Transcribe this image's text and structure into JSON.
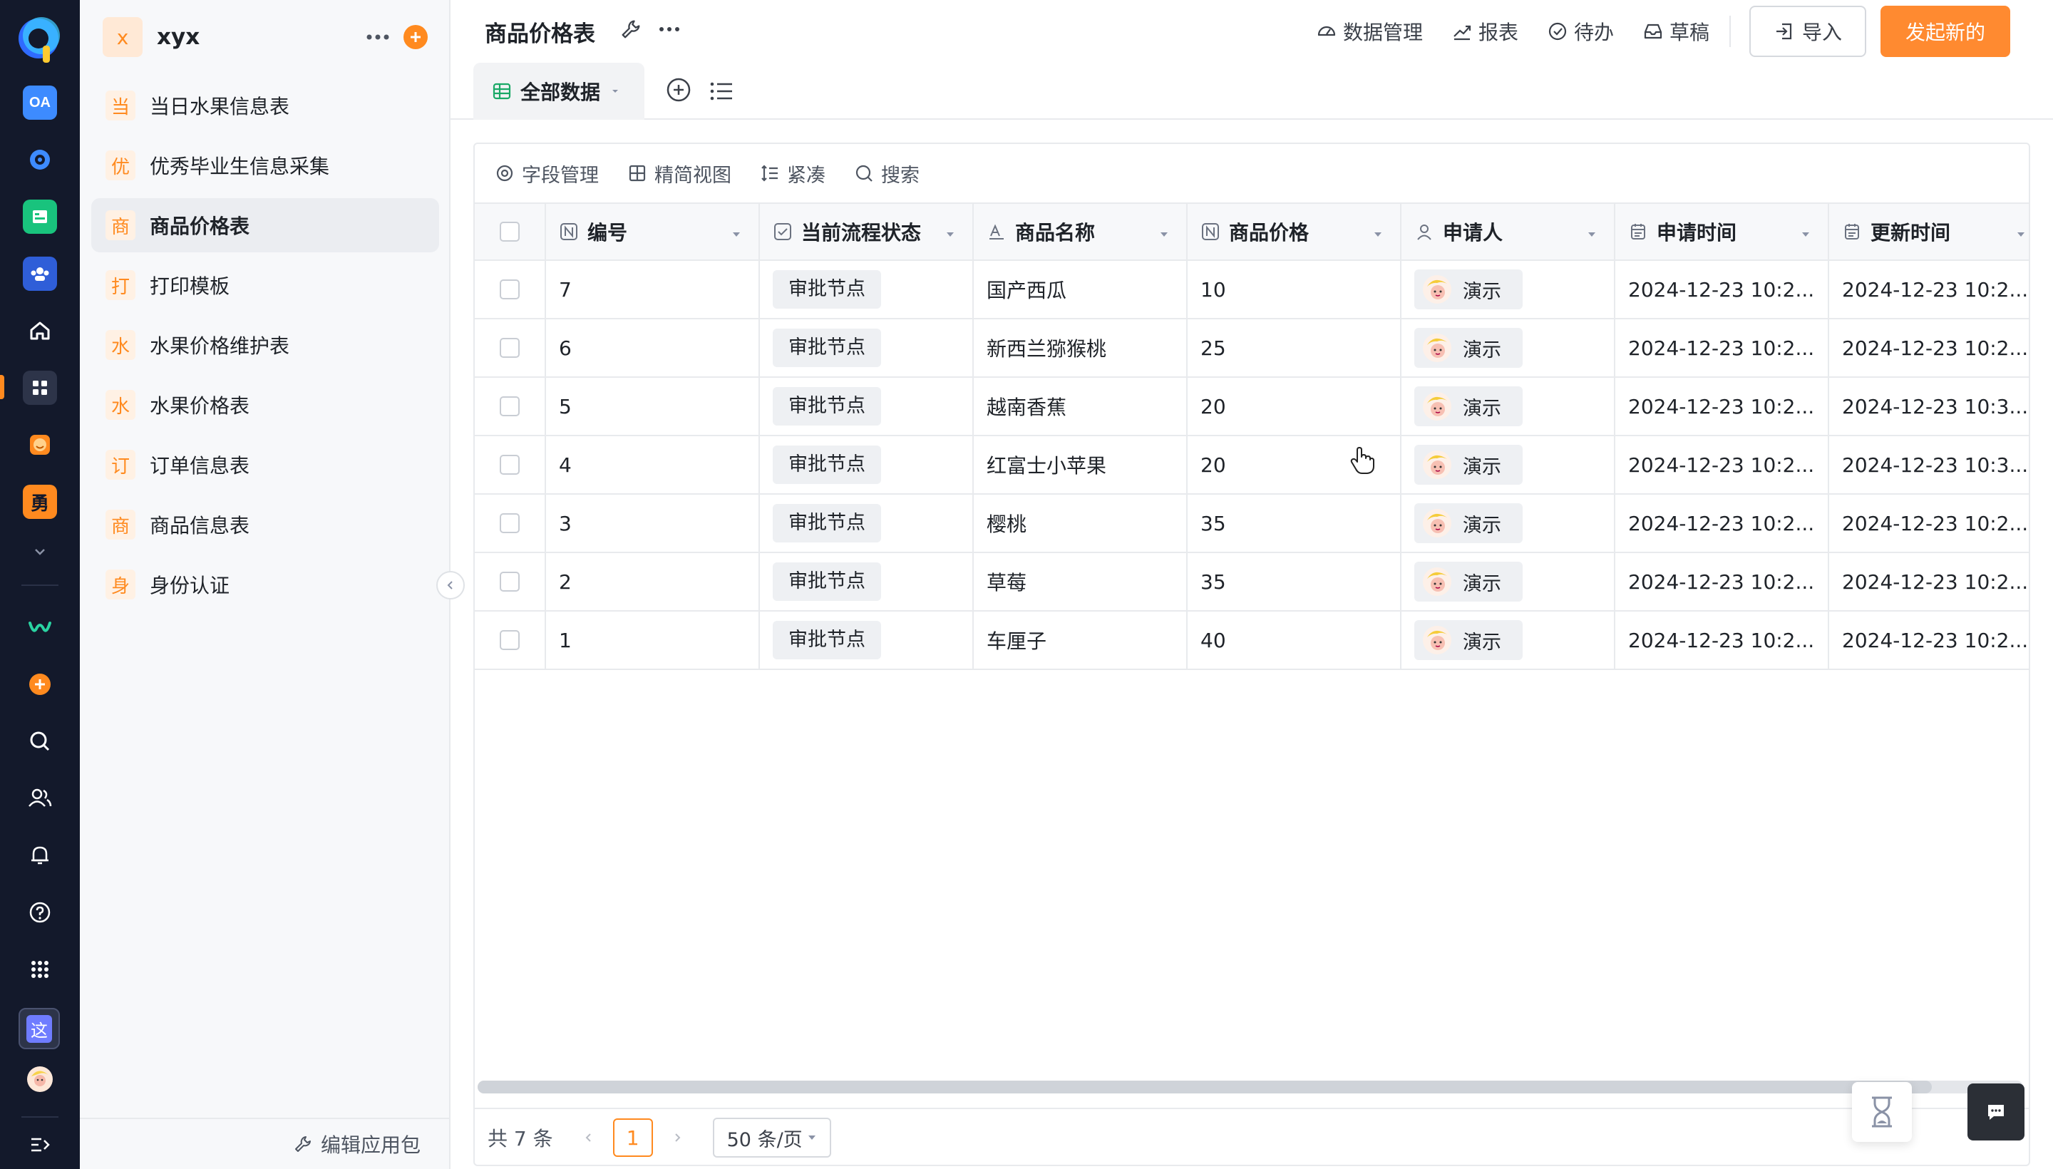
{
  "rail": {
    "logo_letter": "Q",
    "icons": [
      "oa-icon",
      "gear-icon",
      "form-icon",
      "team-icon",
      "home-icon",
      "apps-grid-icon",
      "smile-icon",
      "yong-icon",
      "chevron-down-icon",
      "wave-logo-icon",
      "add-icon",
      "search-icon",
      "users-icon",
      "bell-icon",
      "help-icon",
      "dots-grid-icon",
      "zhe-icon",
      "user-avatar",
      "expand-icon"
    ],
    "oa_label": "OA",
    "yong_label": "勇",
    "zhe_label": "这",
    "accent": "#ff8a1f"
  },
  "sidebar": {
    "app_initial": "x",
    "app_name": "xyx",
    "items": [
      {
        "icon": "当",
        "label": "当日水果信息表"
      },
      {
        "icon": "优",
        "label": "优秀毕业生信息采集"
      },
      {
        "icon": "商",
        "label": "商品价格表",
        "active": true
      },
      {
        "icon": "打",
        "label": "打印模板"
      },
      {
        "icon": "水",
        "label": "水果价格维护表"
      },
      {
        "icon": "水",
        "label": "水果价格表"
      },
      {
        "icon": "订",
        "label": "订单信息表"
      },
      {
        "icon": "商",
        "label": "商品信息表"
      },
      {
        "icon": "身",
        "label": "身份认证"
      }
    ],
    "footer_label": "编辑应用包"
  },
  "topbar": {
    "title": "商品价格表",
    "nav": {
      "data_manage": "数据管理",
      "report": "报表",
      "todo": "待办",
      "draft": "草稿"
    },
    "import_label": "导入",
    "new_label": "发起新的",
    "new_color": "#ff8a30"
  },
  "view": {
    "tab_label": "全部数据"
  },
  "toolbar": {
    "field_manage": "字段管理",
    "simple_view": "精简视图",
    "compact": "紧凑",
    "search": "搜索"
  },
  "table": {
    "columns": [
      "编号",
      "当前流程状态",
      "商品名称",
      "商品价格",
      "申请人",
      "申请时间",
      "更新时间"
    ],
    "rows": [
      {
        "id": "7",
        "status": "审批节点",
        "name": "国产西瓜",
        "price": "10",
        "applicant": "演示",
        "applied": "2024-12-23 10:2...",
        "updated": "2024-12-23 10:2..."
      },
      {
        "id": "6",
        "status": "审批节点",
        "name": "新西兰猕猴桃",
        "price": "25",
        "applicant": "演示",
        "applied": "2024-12-23 10:2...",
        "updated": "2024-12-23 10:2..."
      },
      {
        "id": "5",
        "status": "审批节点",
        "name": "越南香蕉",
        "price": "20",
        "applicant": "演示",
        "applied": "2024-12-23 10:2...",
        "updated": "2024-12-23 10:3..."
      },
      {
        "id": "4",
        "status": "审批节点",
        "name": "红富士小苹果",
        "price": "20",
        "applicant": "演示",
        "applied": "2024-12-23 10:2...",
        "updated": "2024-12-23 10:3..."
      },
      {
        "id": "3",
        "status": "审批节点",
        "name": "樱桃",
        "price": "35",
        "applicant": "演示",
        "applied": "2024-12-23 10:2...",
        "updated": "2024-12-23 10:2..."
      },
      {
        "id": "2",
        "status": "审批节点",
        "name": "草莓",
        "price": "35",
        "applicant": "演示",
        "applied": "2024-12-23 10:2...",
        "updated": "2024-12-23 10:2..."
      },
      {
        "id": "1",
        "status": "审批节点",
        "name": "车厘子",
        "price": "40",
        "applicant": "演示",
        "applied": "2024-12-23 10:2...",
        "updated": "2024-12-23 10:2..."
      }
    ]
  },
  "pager": {
    "total": "共 7 条",
    "current_page": "1",
    "page_size": "50 条/页"
  }
}
